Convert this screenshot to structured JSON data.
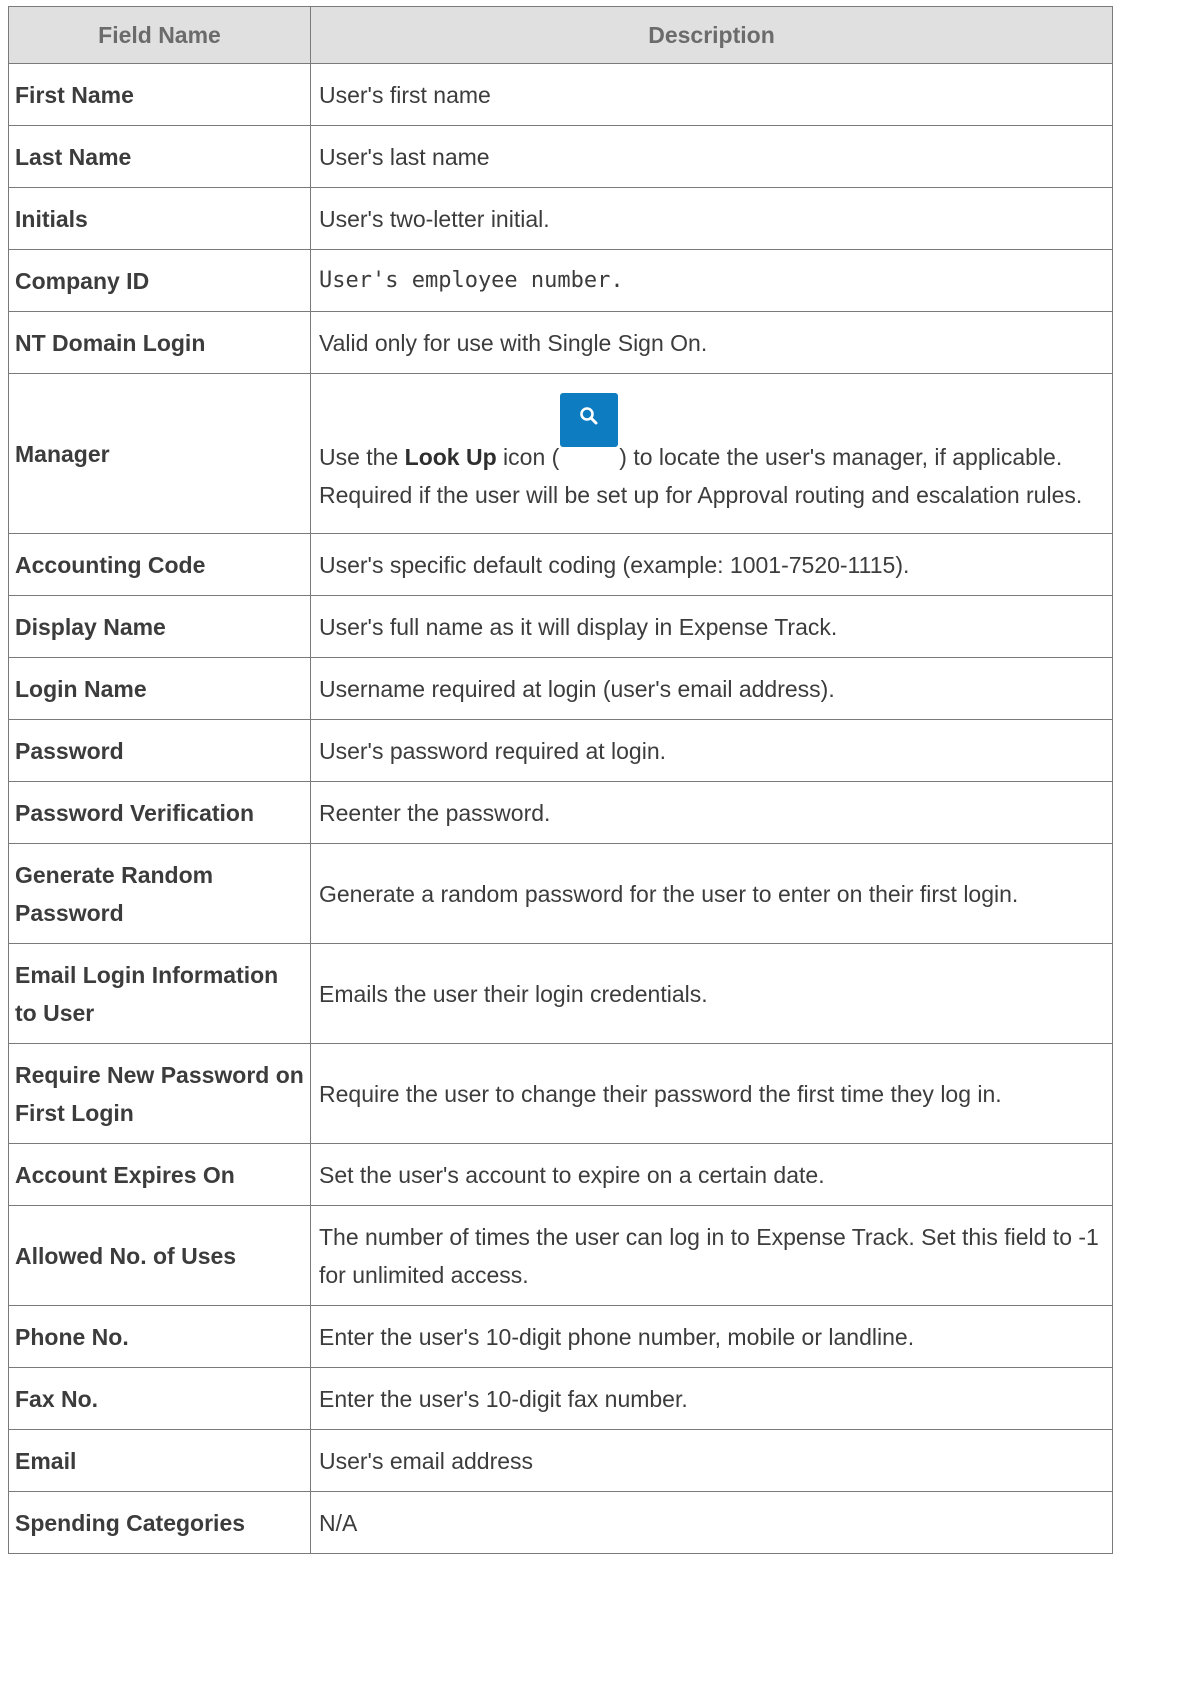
{
  "table": {
    "headers": [
      "Field Name",
      "Description"
    ],
    "rows": [
      {
        "field": "First Name",
        "description": "User's first name"
      },
      {
        "field": "Last Name",
        "description": "User's last name"
      },
      {
        "field": "Initials",
        "description": "User's two-letter initial."
      },
      {
        "field": "Company ID",
        "description": "User's employee number."
      },
      {
        "field": "NT Domain Login",
        "description": "Valid only for use with Single Sign On."
      },
      {
        "field": "Manager",
        "description_pre": "Use the ",
        "description_bold": "Look Up",
        "description_mid": " icon (",
        "description_post": ") to locate the user's manager, if applicable. Required if the user will be set up for Approval routing and escalation rules."
      },
      {
        "field": "Accounting Code",
        "description": "User's specific default coding (example: 1001-7520-1115)."
      },
      {
        "field": "Display Name",
        "description": "User's full name as it will display in Expense Track."
      },
      {
        "field": "Login Name",
        "description": "Username required at login (user's email address)."
      },
      {
        "field": "Password",
        "description": "User's password required at login."
      },
      {
        "field": "Password Verification",
        "description": "Reenter the password."
      },
      {
        "field": "Generate Random Password",
        "description": "Generate a random password for the user to enter on their first login."
      },
      {
        "field": "Email Login Information to User",
        "description": "Emails the user their login credentials."
      },
      {
        "field": "Require New Password on First Login",
        "description": "Require the user to change their password the first time they log in."
      },
      {
        "field": "Account Expires On",
        "description": "Set the user's account to expire on a certain date."
      },
      {
        "field": "Allowed No. of Uses",
        "description": "The number of times the user can log in to Expense Track. Set this field to -1 for unlimited access."
      },
      {
        "field": "Phone No.",
        "description": "Enter the user's 10-digit phone number, mobile or landline."
      },
      {
        "field": "Fax No.",
        "description": "Enter the user's 10-digit fax number."
      },
      {
        "field": "Email",
        "description": "User's email address"
      },
      {
        "field": "Spending Categories",
        "description": "N/A"
      }
    ]
  },
  "icons": {
    "lookup": "search-icon"
  },
  "colors": {
    "header_bg": "#e0e0e0",
    "lookup_button": "#0e7cc1",
    "border": "#7a7a7a"
  }
}
